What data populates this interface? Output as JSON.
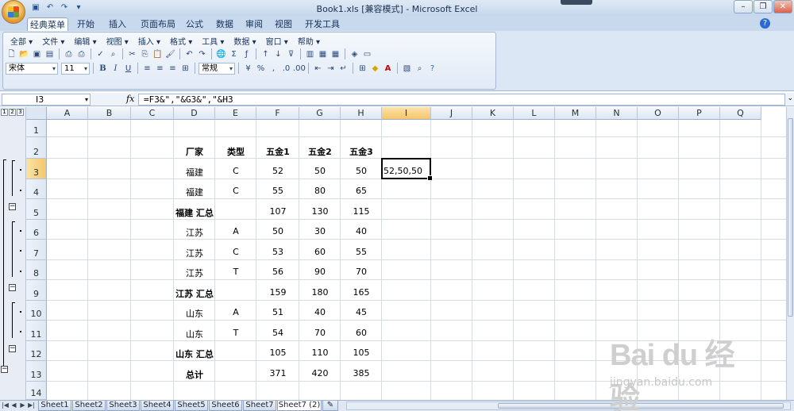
{
  "window": {
    "title": "Book1.xls  [兼容模式] - Microsoft Excel"
  },
  "ribbon_tabs": [
    "经典菜单",
    "开始",
    "插入",
    "页面布局",
    "公式",
    "数据",
    "审阅",
    "视图",
    "开发工具"
  ],
  "classic_menu": [
    "全部 ▾",
    "文件 ▾",
    "编辑 ▾",
    "视图 ▾",
    "插入 ▾",
    "格式 ▾",
    "工具 ▾",
    "数据 ▾",
    "窗口 ▾",
    "帮助 ▾"
  ],
  "toolbar": {
    "font_name": "宋体",
    "font_size": "11",
    "bold": "B",
    "italic": "I",
    "underline": "U",
    "number_format": "常规",
    "percent": "%",
    "comma": ","
  },
  "formula_bar": {
    "name_box": "I3",
    "fx": "fx",
    "formula": "=F3&\",\"&G3&\",\"&H3"
  },
  "columns": [
    "A",
    "B",
    "C",
    "D",
    "E",
    "F",
    "G",
    "H",
    "I",
    "J",
    "K",
    "L",
    "M",
    "N",
    "O",
    "P",
    "Q"
  ],
  "selected_column": "I",
  "rows": [
    "1",
    "2",
    "3",
    "4",
    "5",
    "6",
    "7",
    "8",
    "9",
    "10",
    "11",
    "12",
    "13",
    "14"
  ],
  "selected_row": "3",
  "outline_levels": [
    "1",
    "2",
    "3"
  ],
  "table": {
    "headers": [
      "厂家",
      "类型",
      "五金1",
      "五金2",
      "五金3"
    ],
    "rows": [
      {
        "vendor": "福建",
        "type": "C",
        "v1": "52",
        "v2": "50",
        "v3": "50",
        "i": "52,50,50"
      },
      {
        "vendor": "福建",
        "type": "C",
        "v1": "55",
        "v2": "80",
        "v3": "65",
        "i": ""
      },
      {
        "vendor": "福建 汇总",
        "type": "",
        "v1": "107",
        "v2": "130",
        "v3": "115",
        "i": ""
      },
      {
        "vendor": "江苏",
        "type": "A",
        "v1": "50",
        "v2": "30",
        "v3": "40",
        "i": ""
      },
      {
        "vendor": "江苏",
        "type": "C",
        "v1": "53",
        "v2": "60",
        "v3": "55",
        "i": ""
      },
      {
        "vendor": "江苏",
        "type": "T",
        "v1": "56",
        "v2": "90",
        "v3": "70",
        "i": ""
      },
      {
        "vendor": "江苏 汇总",
        "type": "",
        "v1": "159",
        "v2": "180",
        "v3": "165",
        "i": ""
      },
      {
        "vendor": "山东",
        "type": "A",
        "v1": "51",
        "v2": "40",
        "v3": "45",
        "i": ""
      },
      {
        "vendor": "山东",
        "type": "T",
        "v1": "54",
        "v2": "70",
        "v3": "60",
        "i": ""
      },
      {
        "vendor": "山东 汇总",
        "type": "",
        "v1": "105",
        "v2": "110",
        "v3": "105",
        "i": ""
      },
      {
        "vendor": "总计",
        "type": "",
        "v1": "371",
        "v2": "420",
        "v3": "385",
        "i": ""
      }
    ]
  },
  "sheet_tabs": [
    "Sheet1",
    "Sheet2",
    "Sheet3",
    "Sheet4",
    "Sheet5",
    "Sheet6",
    "Sheet7",
    "Sheet7 (2)"
  ],
  "active_sheet": "Sheet7 (2)",
  "watermark": {
    "main": "Bai du 经验",
    "sub": "jingyan.baidu.com"
  }
}
